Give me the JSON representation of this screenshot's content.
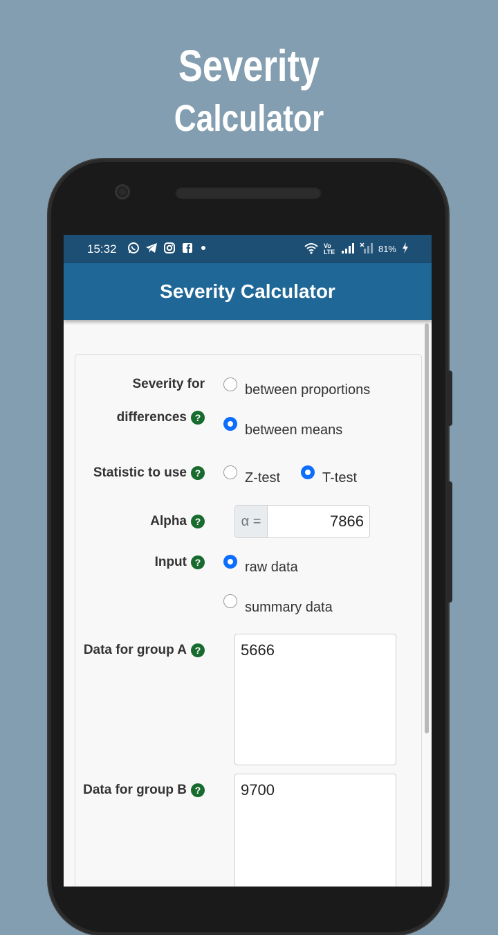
{
  "promo": {
    "title_line1": "Severity",
    "title_line2": "Calculator"
  },
  "status_bar": {
    "time": "15:32",
    "left_icons": [
      "whatsapp-icon",
      "telegram-icon",
      "instagram-icon",
      "facebook-icon",
      "dot-icon"
    ],
    "battery": "81%",
    "volte_label": "Vo LTE",
    "right_icons": [
      "wifi-icon",
      "volte-icon",
      "signal-icon",
      "no-signal-icon",
      "battery-charging-icon"
    ]
  },
  "app_bar": {
    "title": "Severity Calculator"
  },
  "form": {
    "severity": {
      "label_line1": "Severity for",
      "label_line2": "differences",
      "options": [
        {
          "label": "between proportions",
          "selected": false
        },
        {
          "label": "between means",
          "selected": true
        }
      ]
    },
    "statistic": {
      "label": "Statistic to use",
      "options": [
        {
          "label": "Z-test",
          "selected": false
        },
        {
          "label": "T-test",
          "selected": true
        }
      ]
    },
    "alpha": {
      "label": "Alpha",
      "prefix": "α =",
      "value": "7866"
    },
    "input": {
      "label": "Input",
      "options": [
        {
          "label": "raw data",
          "selected": true
        },
        {
          "label": "summary data",
          "selected": false
        }
      ]
    },
    "group_a": {
      "label": "Data for group A",
      "value": "5666"
    },
    "group_b": {
      "label": "Data for group B",
      "value": "9700"
    },
    "help_glyph": "?"
  },
  "colors": {
    "background": "#839eb0",
    "status_bar": "#1d4e73",
    "app_bar": "#1e6797",
    "radio_selected": "#0d6efd",
    "help_badge": "#186b2f"
  }
}
